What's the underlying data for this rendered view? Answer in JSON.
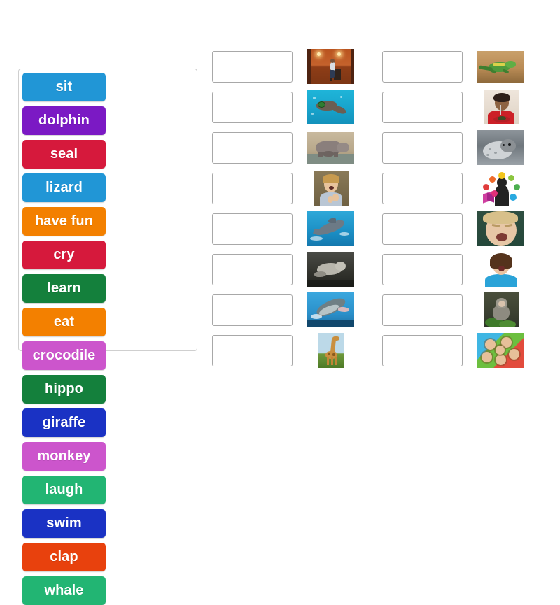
{
  "activity": {
    "type": "match-up",
    "tile_bank": {
      "name": "word-tile-bank",
      "tiles": [
        {
          "label": "sit",
          "color": "#2196d6"
        },
        {
          "label": "dolphin",
          "color": "#7b19c4"
        },
        {
          "label": "seal",
          "color": "#d6193c"
        },
        {
          "label": "lizard",
          "color": "#2196d6"
        },
        {
          "label": "have fun",
          "color": "#f38000"
        },
        {
          "label": "cry",
          "color": "#d6193c"
        },
        {
          "label": "learn",
          "color": "#14803c"
        },
        {
          "label": "eat",
          "color": "#f38000"
        },
        {
          "label": "crocodile",
          "color": "#cc55cc"
        },
        {
          "label": "hippo",
          "color": "#14803c"
        },
        {
          "label": "giraffe",
          "color": "#1a32c4"
        },
        {
          "label": "monkey",
          "color": "#cc55cc"
        },
        {
          "label": "laugh",
          "color": "#22b573"
        },
        {
          "label": "swim",
          "color": "#1a32c4"
        },
        {
          "label": "clap",
          "color": "#e8410d"
        },
        {
          "label": "whale",
          "color": "#22b573"
        }
      ]
    },
    "columns": [
      {
        "name": "answer-column-left",
        "rows": [
          {
            "drop_value": "",
            "image_name": "person-sitting-on-chair-image",
            "image_alt": "person sitting on a chair in an orange room"
          },
          {
            "drop_value": "",
            "image_name": "person-swimming-underwater-image",
            "image_alt": "person swimming underwater with goggles"
          },
          {
            "drop_value": "",
            "image_name": "hippo-image",
            "image_alt": "hippopotamus standing in water"
          },
          {
            "drop_value": "",
            "image_name": "boy-clapping-image",
            "image_alt": "young boy clapping his hands"
          },
          {
            "drop_value": "",
            "image_name": "dolphin-image",
            "image_alt": "dolphin leaping out of blue water"
          },
          {
            "drop_value": "",
            "image_name": "seal-swimming-image",
            "image_alt": "seal swimming in dark water"
          },
          {
            "drop_value": "",
            "image_name": "whale-image",
            "image_alt": "humpback whale breaching the ocean"
          },
          {
            "drop_value": "",
            "image_name": "giraffe-image",
            "image_alt": "giraffe standing on green grass"
          }
        ]
      },
      {
        "name": "answer-column-right",
        "rows": [
          {
            "drop_value": "",
            "image_name": "lizard-image",
            "image_alt": "green lizard on sandy rock"
          },
          {
            "drop_value": "",
            "image_name": "child-eating-image",
            "image_alt": "child eating food with a fork"
          },
          {
            "drop_value": "",
            "image_name": "seal-in-snow-image",
            "image_alt": "spotted seal resting on snow"
          },
          {
            "drop_value": "",
            "image_name": "learning-icons-image",
            "image_alt": "silhouette reading a book with colourful idea icons"
          },
          {
            "drop_value": "",
            "image_name": "crying-child-image",
            "image_alt": "crying toddler"
          },
          {
            "drop_value": "",
            "image_name": "woman-laughing-image",
            "image_alt": "woman in blue top laughing"
          },
          {
            "drop_value": "",
            "image_name": "monkey-image",
            "image_alt": "monkey sitting in a tree"
          },
          {
            "drop_value": "",
            "image_name": "children-having-fun-image",
            "image_alt": "group of children lying in a circle smiling"
          }
        ]
      }
    ]
  },
  "colors": {
    "page_background": "#ffffff",
    "panel_border": "#cfcfcf",
    "dropzone_border": "#a8a8a8",
    "tile_text": "#ffffff"
  }
}
